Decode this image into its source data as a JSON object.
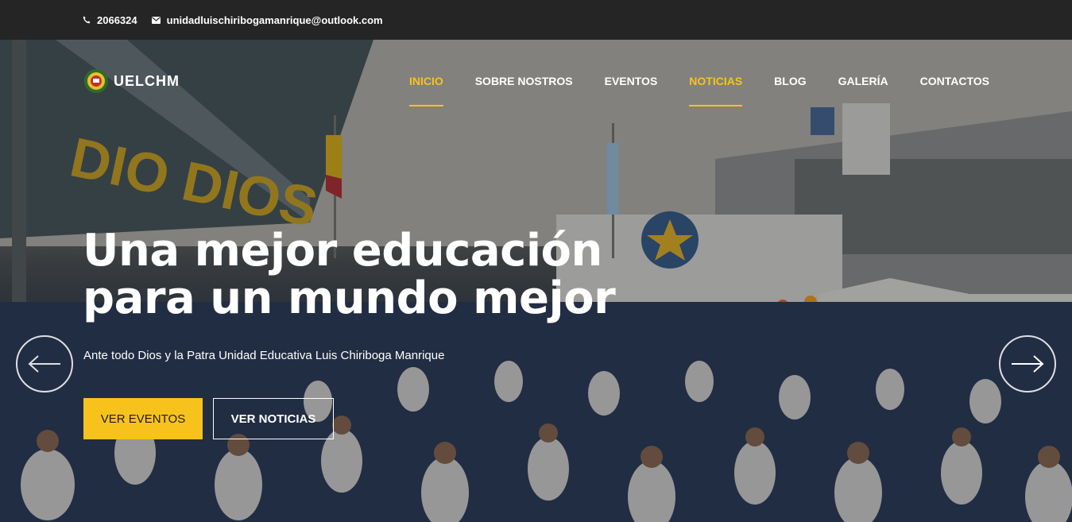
{
  "topbar": {
    "phone": "2066324",
    "email": "unidadluischiribogamanrique@outlook.com",
    "phone_icon": "phone-icon",
    "email_icon": "envelope-icon"
  },
  "brand": {
    "name": "UELCHM",
    "logo_icon": "school-crest-icon"
  },
  "nav": {
    "items": [
      {
        "label": "INICIO",
        "active": true
      },
      {
        "label": "SOBRE NOSTROS",
        "active": false
      },
      {
        "label": "EVENTOS",
        "active": false
      },
      {
        "label": "NOTICIAS",
        "active": true
      },
      {
        "label": "BLOG",
        "active": false
      },
      {
        "label": "GALERÍA",
        "active": false
      },
      {
        "label": "CONTACTOS",
        "active": false
      }
    ]
  },
  "hero": {
    "headline_line1": "Una mejor educación",
    "headline_line2": "para un mundo mejor",
    "subtitle": "Ante todo Dios y la Patra Unidad Educativa Luis Chiriboga Manrique",
    "primary_button": "VER EVENTOS",
    "secondary_button": "VER NOTICIAS",
    "prev_icon": "arrow-left-icon",
    "next_icon": "arrow-right-icon"
  },
  "colors": {
    "accent": "#f8c21d",
    "topbar_bg": "#252525",
    "text": "#ffffff"
  }
}
